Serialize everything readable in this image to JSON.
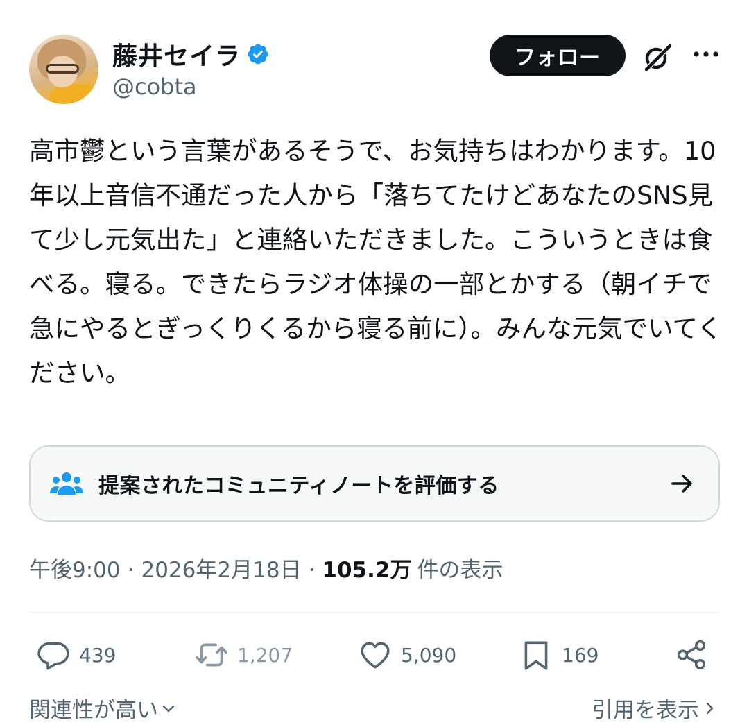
{
  "author": {
    "display_name": "藤井セイラ",
    "handle": "@cobta",
    "verified": true,
    "verified_color": "#1d9bf0"
  },
  "header": {
    "follow_label": "フォロー",
    "grok_icon": "grok-icon",
    "more_icon": "more-icon"
  },
  "tweet": {
    "text": "高市鬱という言葉があるそうで、お気持ちはわかります。10年以上音信不通だった人から「落ちてたけどあなたのSNS見て少し元気出た」と連絡いただきました。こういうときは食べる。寝る。できたらラジオ体操の一部とかする（朝イチで急にやるとぎっくりくるから寝る前に）。みんな元気でいてください。"
  },
  "community_note": {
    "label": "提案されたコミュニティノートを評価する",
    "icon": "people-icon",
    "accent": "#1d9bf0"
  },
  "meta": {
    "time": "午後9:00",
    "separator": "·",
    "date": "2026年2月18日",
    "views_count": "105.2万",
    "views_label": "件の表示"
  },
  "actions": {
    "replies": "439",
    "reposts": "1,207",
    "likes": "5,090",
    "bookmarks": "169"
  },
  "footer": {
    "sort_label": "関連性が高い",
    "quotes_label": "引用を表示"
  }
}
